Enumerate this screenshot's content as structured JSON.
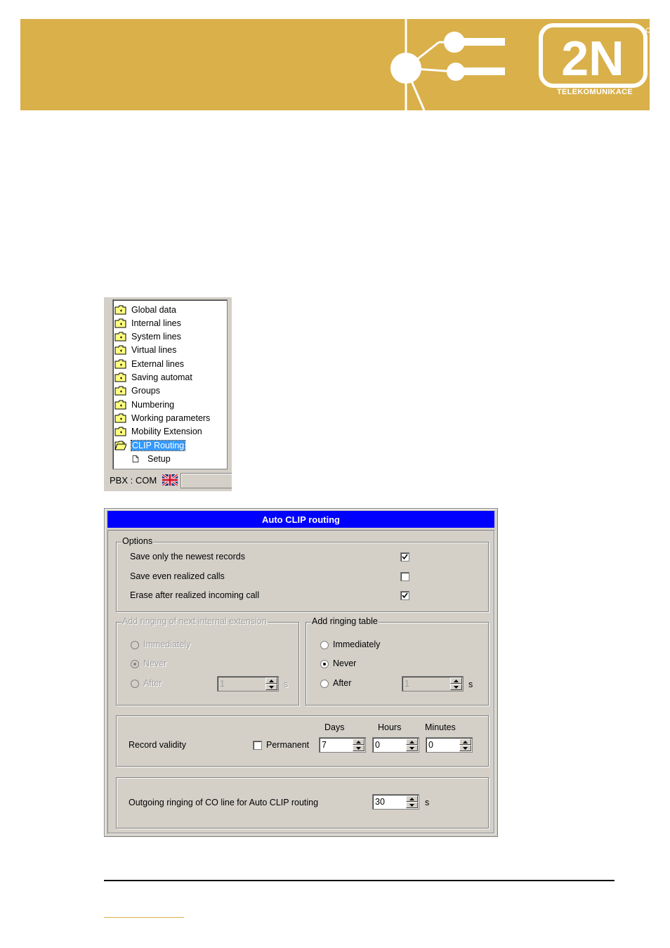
{
  "brand": {
    "logo_text": "2N",
    "subtitle": "TELEKOMUNIKACE",
    "banner_color": "#d9b04a"
  },
  "tree": {
    "items": [
      {
        "label": "Global data",
        "icon": "folder-closed-icon"
      },
      {
        "label": "Internal lines",
        "icon": "folder-closed-icon"
      },
      {
        "label": "System lines",
        "icon": "folder-closed-icon"
      },
      {
        "label": "Virtual lines",
        "icon": "folder-closed-icon"
      },
      {
        "label": "External lines",
        "icon": "folder-closed-icon"
      },
      {
        "label": "Saving automat",
        "icon": "folder-closed-icon"
      },
      {
        "label": "Groups",
        "icon": "folder-closed-icon"
      },
      {
        "label": "Numbering",
        "icon": "folder-closed-icon"
      },
      {
        "label": "Working parameters",
        "icon": "folder-closed-icon"
      },
      {
        "label": "Mobility Extension",
        "icon": "folder-closed-icon"
      },
      {
        "label": "CLIP Routing",
        "icon": "folder-open-icon",
        "selected": true
      }
    ],
    "child": {
      "label": "Setup",
      "icon": "document-icon"
    },
    "status": "PBX : COM",
    "selected_color": "#3399ff"
  },
  "dialog": {
    "title": "Auto CLIP routing",
    "title_color": "#0000ff",
    "options": {
      "legend": "Options",
      "items": [
        {
          "label": "Save only the newest records",
          "checked": true
        },
        {
          "label": "Save even realized calls",
          "checked": false
        },
        {
          "label": "Erase after realized incoming call",
          "checked": true
        }
      ]
    },
    "ringing_internal": {
      "legend": "Add ringing of next internal extension",
      "immediately": "Immediately",
      "never": "Never",
      "after": "After",
      "after_value": "1",
      "unit": "s",
      "selected": "never",
      "enabled": false
    },
    "ringing_table": {
      "legend": "Add ringing table",
      "immediately": "Immediately",
      "never": "Never",
      "after": "After",
      "after_value": "1",
      "unit": "s",
      "selected": "never",
      "enabled": true
    },
    "validity": {
      "label": "Record validity",
      "permanent_label": "Permanent",
      "permanent_checked": false,
      "days_label": "Days",
      "days_value": "7",
      "hours_label": "Hours",
      "hours_value": "0",
      "minutes_label": "Minutes",
      "minutes_value": "0"
    },
    "outgoing": {
      "label": "Outgoing ringing of CO line for Auto CLIP routing",
      "value": "30",
      "unit": "s"
    }
  }
}
